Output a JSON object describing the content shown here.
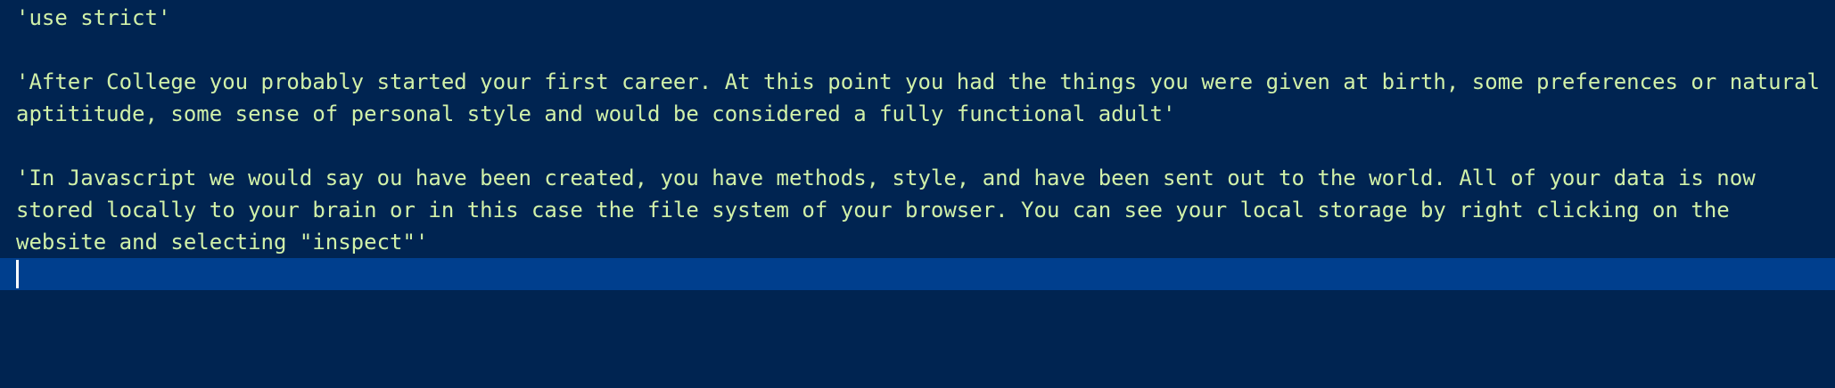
{
  "editor": {
    "lines": [
      "'use strict'",
      "",
      "'After College you probably started your first career. At this point you had the things you were given at birth, some preferences or natural",
      "aptititude, some sense of personal style and would be considered a fully functional adult'",
      "",
      "'In Javascript we would say ou have been created, you have methods, style, and have been sent out to the world. All of your data is now",
      "stored locally to your brain or in this case the file system of your browser. You can see your local storage by right clicking on the",
      "website and selecting \"inspect\"'",
      ""
    ]
  },
  "colors": {
    "background": "#002451",
    "text": "#d1f1a9",
    "active_line": "#003f8e",
    "cursor": "#ffffff"
  }
}
